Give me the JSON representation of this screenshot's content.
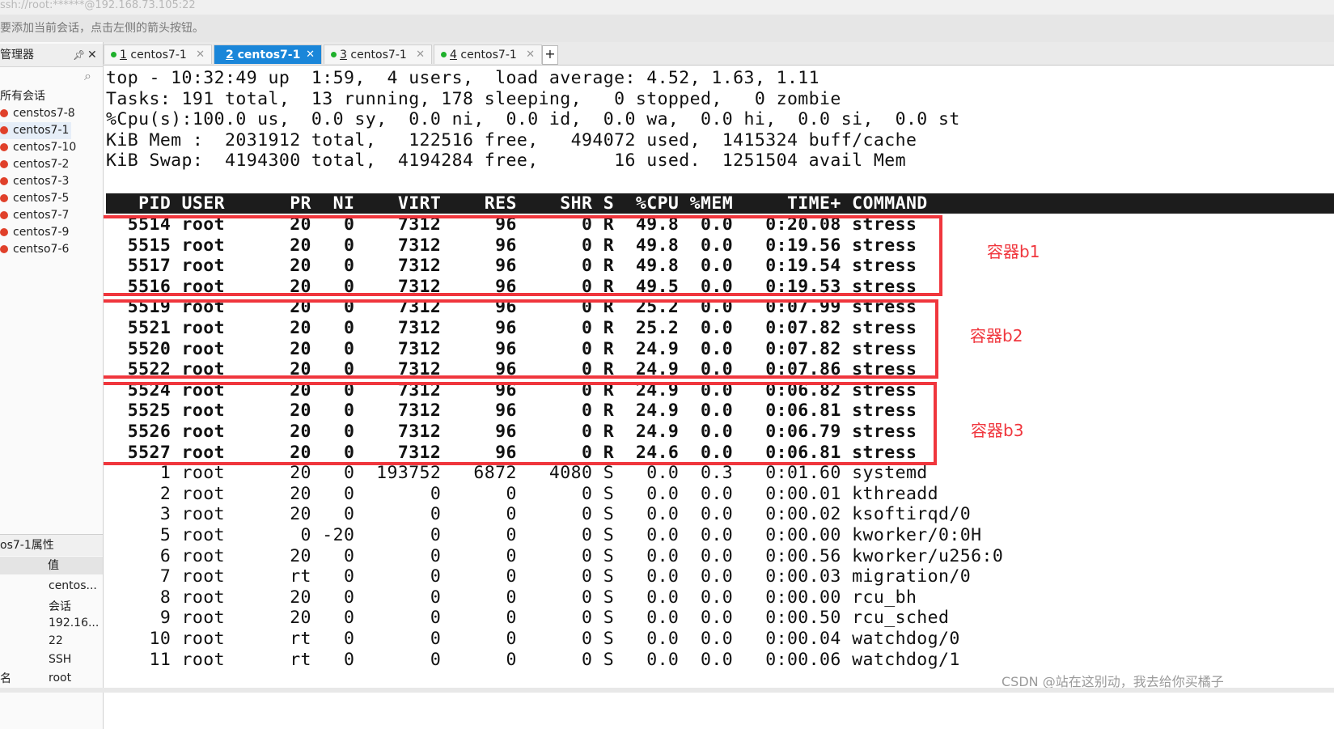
{
  "window": {
    "title": "ssh://root:******@192.168.73.105:22"
  },
  "hint": "要添加当前会话，点击左侧的箭头按钮。",
  "sidebar": {
    "title": "管理器",
    "pin": "ᵖ",
    "close": "✕",
    "root_label": "所有会话",
    "sessions": [
      "censtos7-8",
      "centos7-1",
      "centos7-10",
      "centos7-2",
      "centos7-3",
      "centos7-5",
      "centos7-7",
      "centos7-9",
      "centso7-6"
    ],
    "selected": "centos7-1",
    "props_title": "os7-1属性",
    "props_col": "值",
    "props_name_col": "名",
    "props_values": [
      "centos...",
      "会话",
      "192.16...",
      "22",
      "SSH",
      "root"
    ]
  },
  "tabs": [
    {
      "num": "1",
      "label": "centos7-1",
      "active": false
    },
    {
      "num": "2",
      "label": "centos7-1",
      "active": true
    },
    {
      "num": "3",
      "label": "centos7-1",
      "active": false
    },
    {
      "num": "4",
      "label": "centos7-1",
      "active": false
    }
  ],
  "tab_add": "+",
  "terminal": {
    "summary": [
      "top - 10:32:49 up  1:59,  4 users,  load average: 4.52, 1.63, 1.11",
      "Tasks: 191 total,  13 running, 178 sleeping,   0 stopped,   0 zombie",
      "%Cpu(s):100.0 us,  0.0 sy,  0.0 ni,  0.0 id,  0.0 wa,  0.0 hi,  0.0 si,  0.0 st",
      "KiB Mem :  2031912 total,   122516 free,   494072 used,  1415324 buff/cache",
      "KiB Swap:  4194300 total,  4194284 free,       16 used.  1251504 avail Mem"
    ],
    "header": "   PID USER      PR  NI    VIRT    RES    SHR S  %CPU %MEM     TIME+ COMMAND",
    "processes": [
      {
        "bold": true,
        "text": "  5514 root      20   0    7312     96      0 R  49.8  0.0   0:20.08 stress"
      },
      {
        "bold": true,
        "text": "  5515 root      20   0    7312     96      0 R  49.8  0.0   0:19.56 stress"
      },
      {
        "bold": true,
        "text": "  5517 root      20   0    7312     96      0 R  49.8  0.0   0:19.54 stress"
      },
      {
        "bold": true,
        "text": "  5516 root      20   0    7312     96      0 R  49.5  0.0   0:19.53 stress"
      },
      {
        "bold": true,
        "text": "  5519 root      20   0    7312     96      0 R  25.2  0.0   0:07.99 stress"
      },
      {
        "bold": true,
        "text": "  5521 root      20   0    7312     96      0 R  25.2  0.0   0:07.82 stress"
      },
      {
        "bold": true,
        "text": "  5520 root      20   0    7312     96      0 R  24.9  0.0   0:07.82 stress"
      },
      {
        "bold": true,
        "text": "  5522 root      20   0    7312     96      0 R  24.9  0.0   0:07.86 stress"
      },
      {
        "bold": true,
        "text": "  5524 root      20   0    7312     96      0 R  24.9  0.0   0:06.82 stress"
      },
      {
        "bold": true,
        "text": "  5525 root      20   0    7312     96      0 R  24.9  0.0   0:06.81 stress"
      },
      {
        "bold": true,
        "text": "  5526 root      20   0    7312     96      0 R  24.9  0.0   0:06.79 stress"
      },
      {
        "bold": true,
        "text": "  5527 root      20   0    7312     96      0 R  24.6  0.0   0:06.81 stress"
      },
      {
        "bold": false,
        "text": "     1 root      20   0  193752   6872   4080 S   0.0  0.3   0:01.60 systemd"
      },
      {
        "bold": false,
        "text": "     2 root      20   0       0      0      0 S   0.0  0.0   0:00.01 kthreadd"
      },
      {
        "bold": false,
        "text": "     3 root      20   0       0      0      0 S   0.0  0.0   0:00.02 ksoftirqd/0"
      },
      {
        "bold": false,
        "text": "     5 root       0 -20       0      0      0 S   0.0  0.0   0:00.00 kworker/0:0H"
      },
      {
        "bold": false,
        "text": "     6 root      20   0       0      0      0 S   0.0  0.0   0:00.56 kworker/u256:0"
      },
      {
        "bold": false,
        "text": "     7 root      rt   0       0      0      0 S   0.0  0.0   0:00.03 migration/0"
      },
      {
        "bold": false,
        "text": "     8 root      20   0       0      0      0 S   0.0  0.0   0:00.00 rcu_bh"
      },
      {
        "bold": false,
        "text": "     9 root      20   0       0      0      0 S   0.0  0.0   0:00.50 rcu_sched"
      },
      {
        "bold": false,
        "text": "    10 root      rt   0       0      0      0 S   0.0  0.0   0:00.04 watchdog/0"
      },
      {
        "bold": false,
        "text": "    11 root      rt   0       0      0      0 S   0.0  0.0   0:00.06 watchdog/1"
      }
    ]
  },
  "annotations": [
    "容器b1",
    "容器b2",
    "容器b3"
  ],
  "annotation_color": "#f0363d",
  "watermark": "CSDN @站在这别动，我去给你买橘子"
}
